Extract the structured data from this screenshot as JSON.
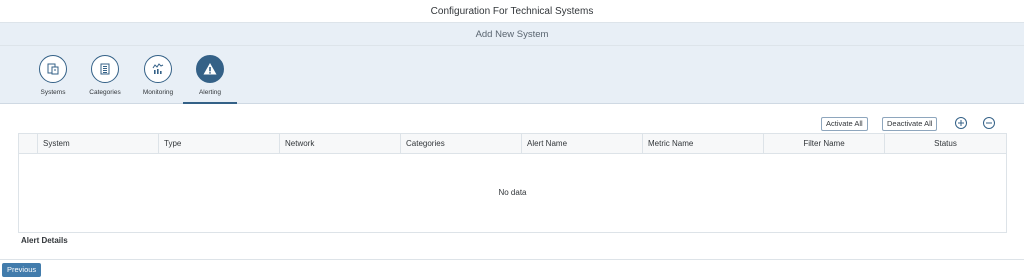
{
  "app": {
    "title": "Configuration For Technical Systems"
  },
  "subheader": {
    "title": "Add New System"
  },
  "tabs": [
    {
      "label": "Systems",
      "icon": "systems-icon",
      "active": false
    },
    {
      "label": "Categories",
      "icon": "list-icon",
      "active": false
    },
    {
      "label": "Monitoring",
      "icon": "monitoring-icon",
      "active": false
    },
    {
      "label": "Alerting",
      "icon": "alert-icon",
      "active": true
    }
  ],
  "toolbar": {
    "activate_all": "Activate All",
    "deactivate_all": "Deactivate All",
    "add_icon": "add-circle-icon",
    "remove_icon": "remove-circle-icon"
  },
  "table": {
    "columns": [
      "System",
      "Type",
      "Network",
      "Categories",
      "Alert Name",
      "Metric Name",
      "Filter Name",
      "Status"
    ],
    "no_data": "No data"
  },
  "details": {
    "title": "Alert Details"
  },
  "footer": {
    "previous": "Previous"
  },
  "colors": {
    "accent": "#346187",
    "header_bg": "#e8eff6",
    "button_blue": "#427cac"
  }
}
